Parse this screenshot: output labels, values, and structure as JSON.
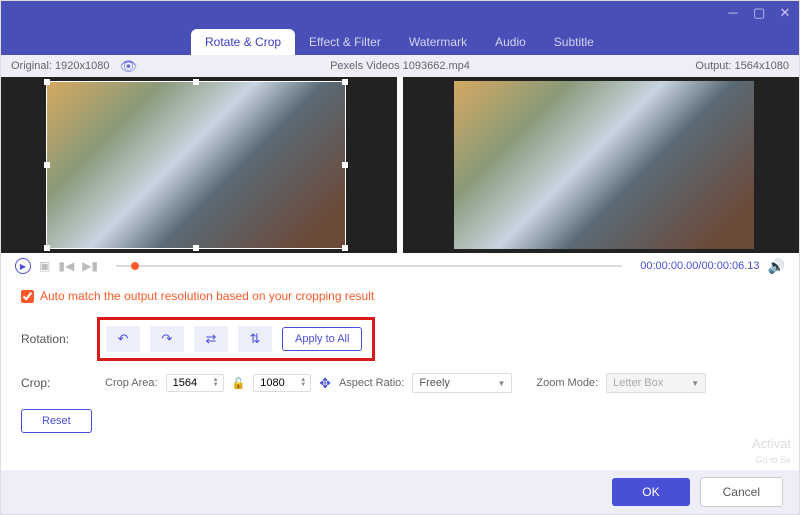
{
  "tabs": [
    {
      "label": "Rotate & Crop"
    },
    {
      "label": "Effect & Filter"
    },
    {
      "label": "Watermark"
    },
    {
      "label": "Audio"
    },
    {
      "label": "Subtitle"
    }
  ],
  "info": {
    "original_label": "Original:",
    "original_res": "1920x1080",
    "filename": "Pexels Videos 1093662.mp4",
    "output_label": "Output:",
    "output_res": "1564x1080"
  },
  "playback": {
    "current": "00:00:00.00",
    "duration": "00:00:06.13"
  },
  "automatch": {
    "checked": true,
    "label": "Auto match the output resolution based on your cropping result"
  },
  "rotation": {
    "label": "Rotation:",
    "apply_label": "Apply to All"
  },
  "crop": {
    "label": "Crop:",
    "area_label": "Crop Area:",
    "width": "1564",
    "height": "1080",
    "aspect_label": "Aspect Ratio:",
    "aspect_value": "Freely",
    "zoom_label": "Zoom Mode:",
    "zoom_value": "Letter Box"
  },
  "buttons": {
    "reset": "Reset",
    "ok": "OK",
    "cancel": "Cancel"
  }
}
